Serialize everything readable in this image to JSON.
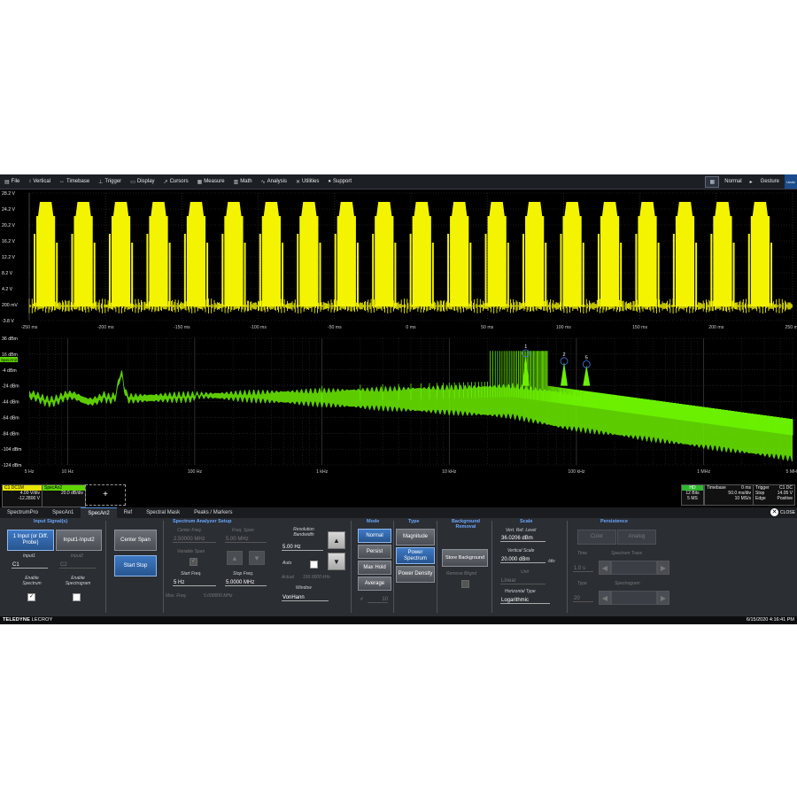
{
  "menu": [
    {
      "icon": "file-icon",
      "glyph": "▤",
      "label": "File"
    },
    {
      "icon": "vertical-icon",
      "glyph": "↕",
      "label": "Vertical"
    },
    {
      "icon": "timebase-icon",
      "glyph": "↔",
      "label": "Timebase"
    },
    {
      "icon": "trigger-icon",
      "glyph": "⊥",
      "label": "Trigger"
    },
    {
      "icon": "display-icon",
      "glyph": "▭",
      "label": "Display"
    },
    {
      "icon": "cursors-icon",
      "glyph": "↗",
      "label": "Cursors"
    },
    {
      "icon": "measure-icon",
      "glyph": "▦",
      "label": "Measure"
    },
    {
      "icon": "math-icon",
      "glyph": "▥",
      "label": "Math"
    },
    {
      "icon": "analysis-icon",
      "glyph": "∿",
      "label": "Analysis"
    },
    {
      "icon": "utilities-icon",
      "glyph": "✕",
      "label": "Utilities"
    },
    {
      "icon": "support-icon",
      "glyph": "●",
      "label": "Support"
    }
  ],
  "menu_right": {
    "mode": "Normal",
    "gesture": "Gesture",
    "undo": "Undo"
  },
  "time_plot": {
    "y_labels": [
      "28.2 V",
      "24.2 V",
      "20.2 V",
      "16.2 V",
      "12.2 V",
      "8.2 V",
      "4.2 V",
      "200 mV",
      "-3.8 V"
    ],
    "x_labels": [
      "-250 ms",
      "-200 ms",
      "-150 ms",
      "-100 ms",
      "-50 ms",
      "0 ms",
      "50 ms",
      "100 ms",
      "150 ms",
      "200 ms",
      "250 ms"
    ],
    "trace_color": "#f4f400"
  },
  "spectrum_plot": {
    "y_labels": [
      "36 dBm",
      "16 dBm",
      "-4 dBm",
      "-24 dBm",
      "-44 dBm",
      "-64 dBm",
      "-84 dBm",
      "-104 dBm",
      "-124 dBm"
    ],
    "x_labels": [
      "5 Hz",
      "10 Hz",
      "100 Hz",
      "1 kHz",
      "10 kHz",
      "100 kHz",
      "1 MHz",
      "5 MHz"
    ],
    "trace_color": "#6cf000",
    "tag": "SpecAn2",
    "markers": [
      "1",
      "2",
      "5"
    ]
  },
  "descriptors": {
    "c1": {
      "label": "C1",
      "coupling": "DC1M",
      "vdiv": "4.00 V/div",
      "offset": "-12.2800 V"
    },
    "spec": {
      "label": "SpecAn2",
      "scale": "20.0 dB/div"
    },
    "add": "+",
    "hd": {
      "label": "HD",
      "bits": "12 Bits",
      "samples": "5 MS"
    },
    "timebase": {
      "title": "Timebase",
      "delay": "0 ms",
      "tdiv": "50.0 ms/div",
      "rate": "10 MS/s"
    },
    "trigger": {
      "title": "Trigger",
      "ch": "C1",
      "coupling": "DC",
      "mode": "Stop",
      "level": "14.05 V",
      "type": "Edge",
      "slope": "Positive"
    }
  },
  "dialog": {
    "tabs": [
      "SpectrumPro",
      "SpecAn1",
      "SpecAn2",
      "Ref",
      "Spectral Mask",
      "Peaks / Markers"
    ],
    "active_tab": "SpecAn2",
    "close": "CLOSE",
    "input": {
      "title": "Input Signal(s)",
      "btn_single": "1 Input (or Diff. Probe)",
      "btn_diff": "Input1-Input2",
      "input1_label": "Input1",
      "input1": "C1",
      "input2_label": "Input2",
      "input2": "C2",
      "enable_spectrum": "Enable Spectrum",
      "enable_spectrogram": "Enable Spectrogram"
    },
    "span_buttons": {
      "center_span": "Center Span",
      "start_stop": "Start Stop"
    },
    "setup": {
      "title": "Spectrum Analyzer Setup",
      "center_freq_label": "Center Freq.",
      "center_freq": "2.50000 MHz",
      "freq_span_label": "Freq. Span",
      "freq_span": "5.00 MHz",
      "variable_span": "Variable Span",
      "start_freq_label": "Start Freq.",
      "start_freq": "5 Hz",
      "stop_freq_label": "Stop Freq.",
      "stop_freq": "5.0000 MHz",
      "max_freq_label": "Max. Freq.",
      "max_freq": "5.000000 MHz"
    },
    "rbw": {
      "title": "Resolution Bandwidth",
      "value": "5.00 Hz",
      "auto": "Auto",
      "actual_label": "Actual",
      "actual": "150.0000 kHz",
      "window_label": "Window",
      "window": "VonHann"
    },
    "mode": {
      "title": "Mode",
      "options": [
        "Normal",
        "Persist",
        "Max Hold",
        "Average"
      ],
      "selected": "Normal",
      "count_label": "#",
      "count": "10"
    },
    "type": {
      "title": "Type",
      "options": [
        "Magnitude",
        "Power Spectrum",
        "Power Density"
      ],
      "selected": "Power Spectrum"
    },
    "background": {
      "title": "Background Removal",
      "store": "Store Background",
      "remove_label": "Remove Bkgnd"
    },
    "scale": {
      "title": "Scale",
      "ref_label": "Vert. Ref. Level",
      "ref": "36.0206 dBm",
      "vscale_label": "Vertical Scale",
      "vscale": "20.000 dBm",
      "vscale_unit": "/div",
      "unit_label": "Unit",
      "unit": "Linear",
      "hscale_label": "Horizontal Type",
      "hscale": "Logarithmic"
    },
    "persistence": {
      "title": "Persistence",
      "color": "Color",
      "analog": "Analog",
      "time_label": "Time",
      "time": "1.0 s",
      "trace_label": "Spectrum Trace",
      "type_label": "Type",
      "type": "20",
      "spectrogram_label": "Spectrogram"
    }
  },
  "status": {
    "brand": "TELEDYNE",
    "brand2": "LECROY",
    "datetime": "6/15/2020 4:16:41 PM"
  }
}
